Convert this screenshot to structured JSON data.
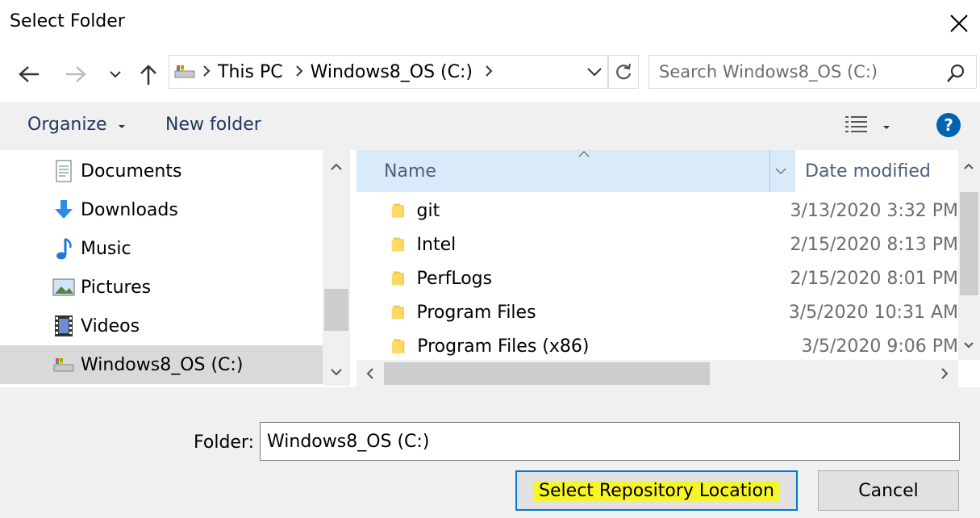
{
  "window": {
    "title": "Select Folder"
  },
  "address": {
    "segments": [
      "This PC",
      "Windows8_OS (C:)"
    ]
  },
  "search": {
    "placeholder": "Search Windows8_OS (C:)"
  },
  "toolbar": {
    "organize": "Organize",
    "new_folder": "New folder"
  },
  "nav": {
    "items": [
      {
        "label": "Documents",
        "icon": "documents-icon"
      },
      {
        "label": "Downloads",
        "icon": "downloads-icon"
      },
      {
        "label": "Music",
        "icon": "music-icon"
      },
      {
        "label": "Pictures",
        "icon": "pictures-icon"
      },
      {
        "label": "Videos",
        "icon": "videos-icon"
      },
      {
        "label": "Windows8_OS (C:)",
        "icon": "drive-icon",
        "selected": true
      }
    ]
  },
  "list": {
    "columns": {
      "name": "Name",
      "date": "Date modified"
    },
    "rows": [
      {
        "name": "git",
        "date": "3/13/2020 3:32 PM"
      },
      {
        "name": "Intel",
        "date": "2/15/2020 8:13 PM"
      },
      {
        "name": "PerfLogs",
        "date": "2/15/2020 8:01 PM"
      },
      {
        "name": "Program Files",
        "date": "3/5/2020 10:31 AM"
      },
      {
        "name": "Program Files (x86)",
        "date": "3/5/2020 9:06 PM"
      }
    ]
  },
  "footer": {
    "folder_label": "Folder:",
    "folder_value": "Windows8_OS (C:)",
    "select_button": "Select Repository Location",
    "cancel_button": "Cancel"
  },
  "colors": {
    "accent": "#0078d7",
    "highlight": "#f5f52a",
    "selection": "#d9ebf9"
  }
}
